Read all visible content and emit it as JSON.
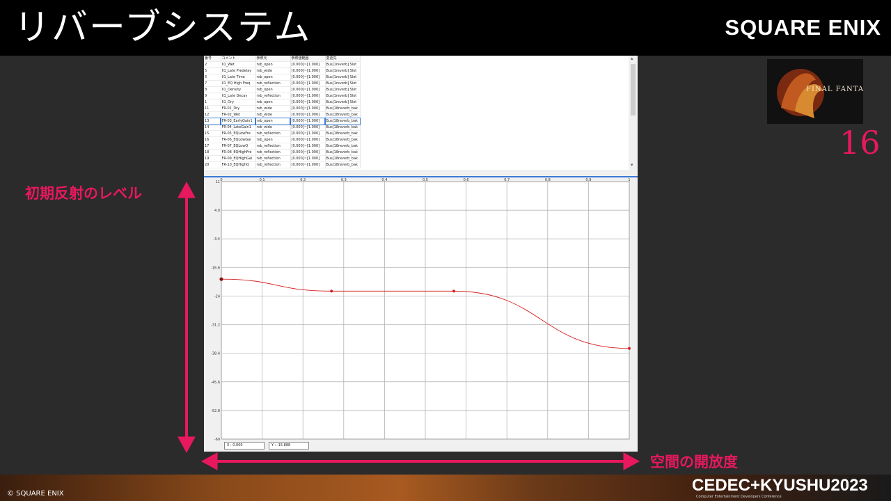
{
  "slide": {
    "title": "リバーブシステム",
    "brand": "SQUARE ENIX",
    "page_number": "16",
    "game_logo": "FINAL FANTASY XVI",
    "label_y": "初期反射のレベル",
    "label_x": "空間の開放度",
    "copyright": "© SQUARE ENIX",
    "event": "CEDEC+KYUSHU2023",
    "event_sub": "Computer Entertainment Developers Conference",
    "accent_color": "#e8185f"
  },
  "table": {
    "headers": [
      "番号",
      "コメント",
      "参照元",
      "参照値範囲",
      "変更先"
    ],
    "selected_row": 9,
    "rows": [
      [
        "2",
        "II1_Wet",
        "rvb_open",
        "[0.000]~[1.000]",
        "Bus[1reverb] Slot"
      ],
      [
        "5",
        "II1_Late Predelay",
        "rvb_wide",
        "[0.000]~[1.000]",
        "Bus[1reverb] Slot"
      ],
      [
        "6",
        "II1_Late Time",
        "rvb_open",
        "[0.000]~[1.000]",
        "Bus[1reverb] Slot"
      ],
      [
        "7",
        "II1_EQ High Freq",
        "rvb_reflection",
        "[0.000]~[1.000]",
        "Bus[1reverb] Slot"
      ],
      [
        "8",
        "II1_Density",
        "rvb_open",
        "[0.000]~[1.000]",
        "Bus[1reverb] Slot"
      ],
      [
        "9",
        "II1_Late Decay",
        "rvb_reflection",
        "[0.000]~[1.000]",
        "Bus[1reverb] Slot"
      ],
      [
        "1",
        "II1_Dry",
        "rvb_open",
        "[0.000]~[1.000]",
        "Bus[1reverb] Slot"
      ],
      [
        "11",
        "FR-01_Dry",
        "rvb_wide",
        "[0.000]~[1.000]",
        "Bus[18reverb_bak"
      ],
      [
        "12",
        "FR-02_Wet",
        "rvb_wide",
        "[0.000]~[1.000]",
        "Bus[18reverb_bak"
      ],
      [
        "13",
        "FR-03_EarlyGain1",
        "rvb_open",
        "[0.000]~[1.000]",
        "Bus[18reverb_bak"
      ],
      [
        "14",
        "FR-04_LateGain1",
        "rvb_wide",
        "[0.000]~[1.000]",
        "Bus[18reverb_bak"
      ],
      [
        "15",
        "FR-05_EQLowFre",
        "rvb_reflection",
        "[0.000]~[1.000]",
        "Bus[18reverb_bak"
      ],
      [
        "16",
        "FR-06_EQLowGai",
        "rvb_open",
        "[0.000]~[1.000]",
        "Bus[18reverb_bak"
      ],
      [
        "17",
        "FR-07_EQLowQ",
        "rvb_reflection",
        "[0.000]~[1.000]",
        "Bus[18reverb_bak"
      ],
      [
        "18",
        "FR-08_EQHighFre",
        "rvb_reflection",
        "[0.000]~[1.000]",
        "Bus[18reverb_bak"
      ],
      [
        "19",
        "FR-09_EQHighGai",
        "rvb_reflection",
        "[0.000]~[1.000]",
        "Bus[18reverb_bak"
      ],
      [
        "20",
        "FR-10_EQHighQ",
        "rvb_reflection",
        "[0.000]~[1.000]",
        "Bus[18reverb_bak"
      ]
    ]
  },
  "readout": {
    "x": "X : 0.000",
    "y": "Y : -15.888"
  },
  "chart_data": {
    "type": "line",
    "xlim": [
      0,
      1
    ],
    "ylim": [
      -60,
      11
    ],
    "x_ticks": [
      "0",
      "0.1",
      "0.2",
      "0.3",
      "0.4",
      "0.5",
      "0.6",
      "0.7",
      "0.8",
      "0.9",
      "1"
    ],
    "y_ticks": [
      "11",
      "4.0",
      "-3.4",
      "-16.6",
      "-24",
      "-31.2",
      "-38.4",
      "-45.6",
      "-52.8",
      "-60"
    ],
    "grid": true,
    "points": [
      {
        "x": 0.0,
        "y": -15.9
      },
      {
        "x": 0.27,
        "y": -19.2
      },
      {
        "x": 0.57,
        "y": -19.2
      },
      {
        "x": 1.0,
        "y": -35.0
      }
    ],
    "line_color": "#d62020"
  }
}
